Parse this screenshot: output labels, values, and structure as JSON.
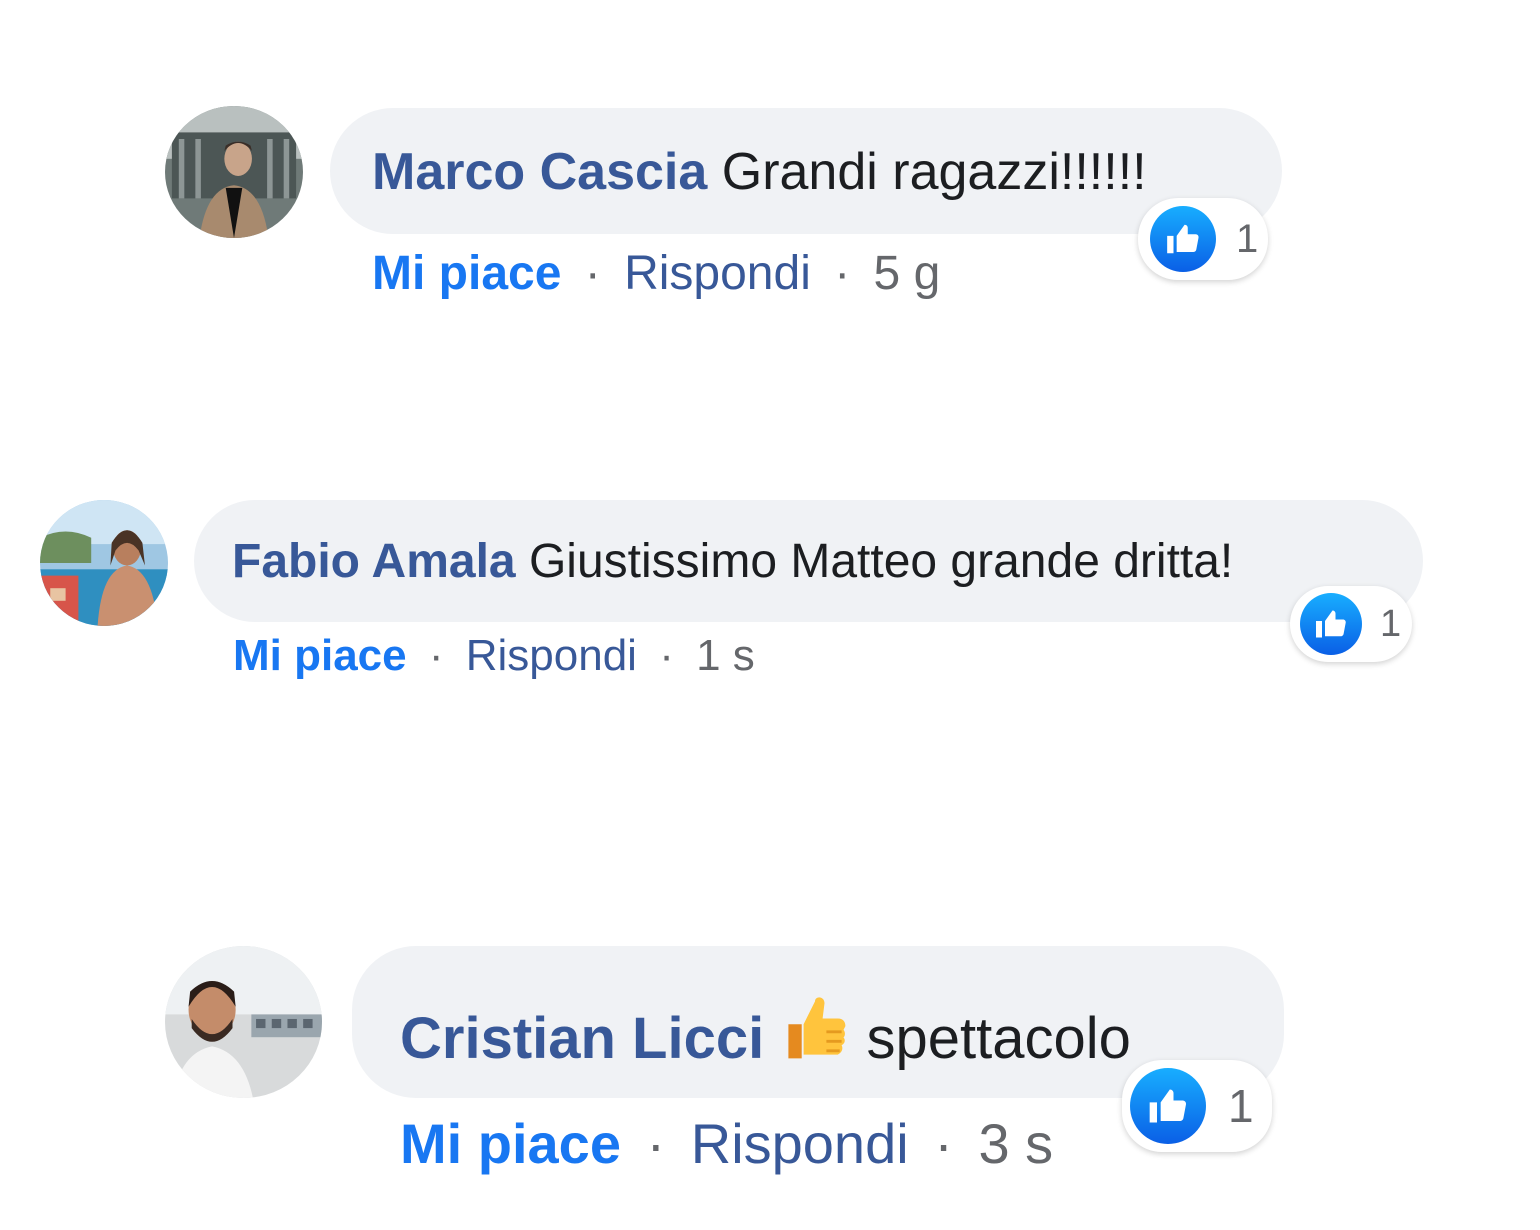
{
  "colors": {
    "author": "#385898",
    "like_action": "#1877f2",
    "bubble": "#f0f2f5",
    "reaction_blue": "#1877f2"
  },
  "comments": [
    {
      "author": "Marco Cascia",
      "text": "Grandi ragazzi!!!!!!",
      "like_label": "Mi piace",
      "reply_label": "Rispondi",
      "separator": "·",
      "time": "5 g",
      "reaction_icon": "like-icon",
      "reaction_count": "1"
    },
    {
      "author": "Fabio Amala",
      "text": "Giustissimo Matteo grande dritta!",
      "like_label": "Mi piace",
      "reply_label": "Rispondi",
      "separator": "·",
      "time": "1 s",
      "reaction_icon": "like-icon",
      "reaction_count": "1"
    },
    {
      "author": "Cristian Licci",
      "emoji": "thumbs-up-emoji",
      "text": "spettacolo",
      "like_label": "Mi piace",
      "reply_label": "Rispondi",
      "separator": "·",
      "time": "3 s",
      "reaction_icon": "like-icon",
      "reaction_count": "1"
    }
  ]
}
